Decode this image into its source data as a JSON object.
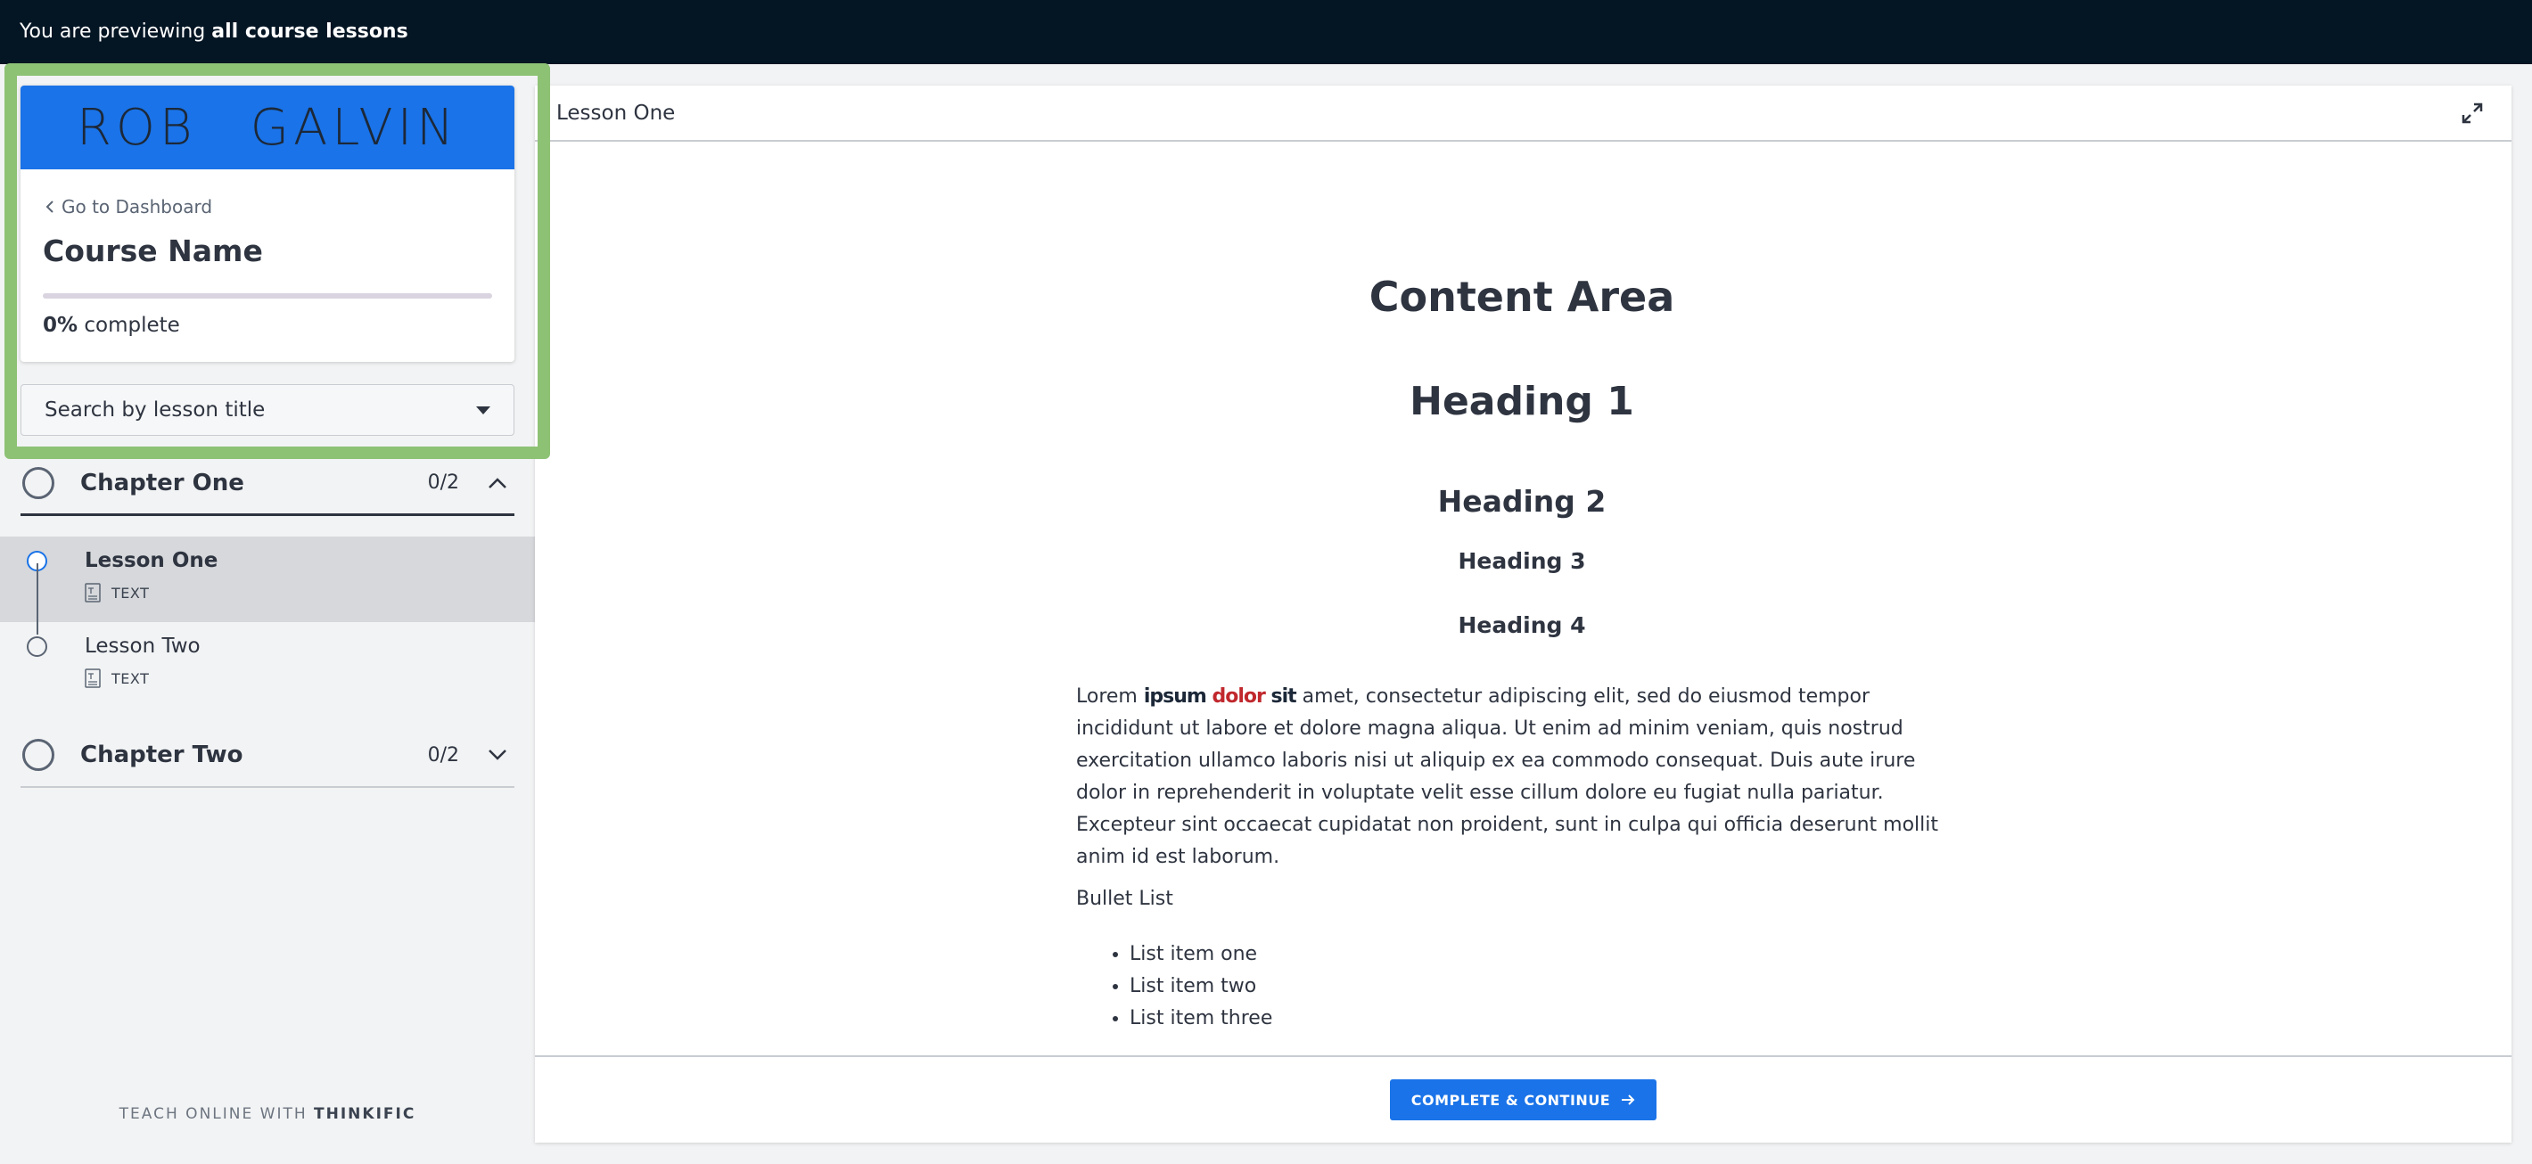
{
  "banner": {
    "prefix": "You are previewing ",
    "bold": "all course lessons"
  },
  "logo": {
    "word1": "ROB",
    "word2": "GALVIN"
  },
  "course": {
    "dashboard_link": "Go to Dashboard",
    "name": "Course Name",
    "progress_percent": 0,
    "progress_value": "0%",
    "progress_suffix": " complete"
  },
  "search": {
    "placeholder": "Search by lesson title"
  },
  "chapters": [
    {
      "title": "Chapter One",
      "count": "0/2",
      "expanded": true,
      "lessons": [
        {
          "title": "Lesson One",
          "type": "TEXT",
          "active": true
        },
        {
          "title": "Lesson Two",
          "type": "TEXT",
          "active": false
        }
      ]
    },
    {
      "title": "Chapter Two",
      "count": "0/2",
      "expanded": false
    }
  ],
  "footer_brand": {
    "prefix": "TEACH ONLINE WITH ",
    "name": "THINKIFIC"
  },
  "content": {
    "header_title": "Lesson One",
    "title": "Content Area",
    "h1": "Heading 1",
    "h2": "Heading 2",
    "h3": "Heading 3",
    "h4": "Heading 4",
    "para_start": "Lorem ",
    "para_ipsum": "ipsum",
    "para_dolor": " dolor",
    "para_sit": " sit",
    "para_rest": " amet, consectetur adipiscing elit, sed do eiusmod tempor incididunt ut labore et dolore magna aliqua. Ut enim ad minim veniam, quis nostrud exercitation ullamco laboris nisi ut aliquip ex ea commodo consequat. Duis aute irure dolor in reprehenderit in voluptate velit esse cillum dolore eu fugiat nulla pariatur. Excepteur sint occaecat cupidatat non proident, sunt in culpa qui officia deserunt mollit anim id est laborum.",
    "bullet_label": "Bullet List",
    "bullets": [
      "List item one",
      "List item two",
      "List item three"
    ],
    "cta_label": "COMPLETE & CONTINUE"
  },
  "colors": {
    "accent": "#1a73e8",
    "topbar": "#041524",
    "highlight": "#8dc275",
    "red": "#c0282d"
  },
  "icons": {
    "dashboard": "chevron-left-icon",
    "search": "caret-down-icon",
    "chapter_open": "chevron-up-icon",
    "chapter_closed": "chevron-down-icon",
    "lesson_type": "text-document-icon",
    "expand": "expand-icon",
    "cta": "arrow-right-icon"
  }
}
